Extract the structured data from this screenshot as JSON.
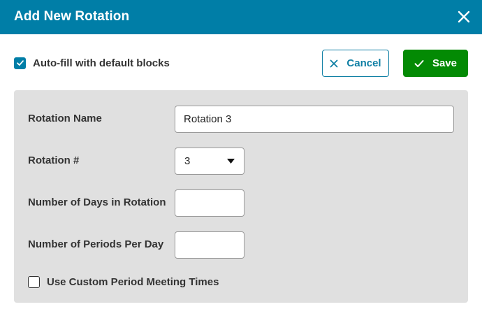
{
  "dialog": {
    "title": "Add New Rotation"
  },
  "toolbar": {
    "autofill_label": "Auto-fill with default blocks",
    "autofill_checked": true,
    "cancel_label": "Cancel",
    "save_label": "Save"
  },
  "form": {
    "rotation_name": {
      "label": "Rotation Name",
      "value": "Rotation 3"
    },
    "rotation_number": {
      "label": "Rotation #",
      "value": "3"
    },
    "days_in_rotation": {
      "label": "Number of Days in Rotation",
      "value": ""
    },
    "periods_per_day": {
      "label": "Number of Periods Per Day",
      "value": ""
    },
    "custom_period_times": {
      "label": "Use Custom Period Meeting Times",
      "checked": false
    }
  },
  "colors": {
    "header": "#007ea7",
    "save": "#038a04",
    "cancel_border": "#0f7fa4",
    "panel": "#e0e0e0"
  },
  "icons": {
    "close": "close-icon",
    "check": "check-icon",
    "cancel": "x-icon",
    "save": "checkmark-icon",
    "dropdown": "caret-down-icon"
  }
}
